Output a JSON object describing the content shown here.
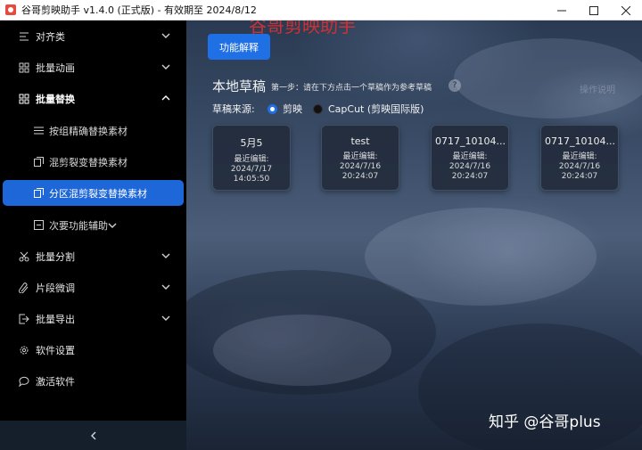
{
  "window": {
    "title": "谷哥剪映助手 v1.4.0 (正式版) - 有效期至 2024/8/12",
    "controls": [
      "minimize",
      "maximize",
      "close"
    ]
  },
  "sidebar": {
    "items": [
      {
        "label": "对齐类",
        "icon": "align-icon"
      },
      {
        "label": "批量动画",
        "icon": "grid-icon"
      },
      {
        "label": "批量替换",
        "icon": "grid-icon",
        "expanded": true,
        "children": [
          {
            "label": "按组精确替换素材",
            "icon": "list-icon"
          },
          {
            "label": "混剪裂变替换素材",
            "icon": "copy-icon"
          },
          {
            "label": "分区混剪裂变替换素材",
            "icon": "copy-icon",
            "active": true
          },
          {
            "label": "次要功能辅助",
            "icon": "square-icon"
          }
        ]
      },
      {
        "label": "批量分割",
        "icon": "scissors-icon"
      },
      {
        "label": "片段微调",
        "icon": "clip-icon"
      },
      {
        "label": "批量导出",
        "icon": "export-icon"
      },
      {
        "label": "软件设置",
        "icon": "gear-icon"
      },
      {
        "label": "激活软件",
        "icon": "chat-icon"
      }
    ],
    "collapse_icon": "chevron-left-icon"
  },
  "main": {
    "banner_title": "谷哥剪映助手",
    "explain_button": "功能解释",
    "section_title": "本地草稿",
    "step_text": "第一步：请在下方点击一个草稿作为参考草稿",
    "ghost_text": "操作说明",
    "source_label": "草稿来源:",
    "sources": [
      {
        "label": "剪映",
        "selected": true
      },
      {
        "label": "CapCut (剪映国际版)",
        "selected": false
      }
    ],
    "drafts": [
      {
        "name": "5月5",
        "label": "最近编辑:",
        "date": "2024/7/17",
        "time": "14:05:50"
      },
      {
        "name": "test",
        "label": "最近编辑:",
        "date": "2024/7/16",
        "time": "20:24:07"
      },
      {
        "name": "0717_10104...",
        "label": "最近编辑:",
        "date": "2024/7/16",
        "time": "20:24:07"
      },
      {
        "name": "0717_10104...",
        "label": "最近编辑:",
        "date": "2024/7/16",
        "time": "20:24:07"
      }
    ],
    "watermark": "知乎 @谷哥plus"
  },
  "colors": {
    "accent": "#1f6fe5",
    "sidebar_bg": "#000000",
    "active_item": "#1d67d8",
    "banner_red": "#e03030"
  }
}
